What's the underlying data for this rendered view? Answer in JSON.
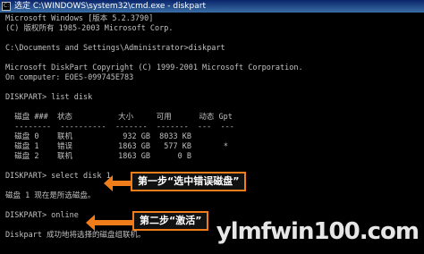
{
  "window": {
    "title": "选定 C:\\WINDOWS\\system32\\cmd.exe - diskpart",
    "icon": "cmd-icon"
  },
  "console_lines": [
    "Microsoft Windows [版本 5.2.3790]",
    "(C) 版权所有 1985-2003 Microsoft Corp.",
    "",
    "C:\\Documents and Settings\\Administrator>diskpart",
    "",
    "Microsoft DiskPart Copyright (C) 1999-2001 Microsoft Corporation.",
    "On computer: EOES-099745E783",
    "",
    "DISKPART> list disk",
    "",
    "  磁盘 ###  状态          大小     可用      动态 Gpt",
    "  --------  ----------  -------  -------  ---  ---",
    "  磁盘 0    联机           932 GB  8033 KB",
    "  磁盘 1    错误          1863 GB   577 KB       *",
    "  磁盘 2    联机          1863 GB      0 B",
    "",
    "DISKPART> select disk 1",
    "",
    "磁盘 1 现在是所选磁盘。",
    "",
    "DISKPART> online",
    "",
    "Diskpart 成功地将选择的磁盘组联机。"
  ],
  "annotations": {
    "step1": "第一步“选中错误磁盘”",
    "step2": "第二步“激活”"
  },
  "watermark": "ylmfwin100.com",
  "colors": {
    "callout_border": "#f07c1a",
    "title_bar": "#0a246a",
    "console_text": "#c0c0c0"
  }
}
